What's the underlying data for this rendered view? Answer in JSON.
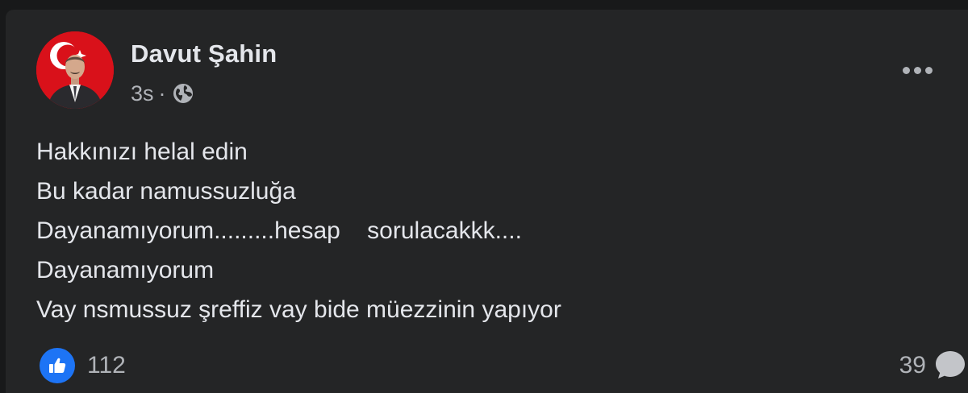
{
  "post": {
    "author": "Davut Şahin",
    "time": "3s",
    "separator": "·",
    "privacy_icon": "globe-icon",
    "more_icon": "more-options-icon",
    "lines": [
      "Hakkınızı helal edin",
      "Bu kadar namussuzluğa",
      "Dayanamıyorum.........hesap    sorulacakkk....",
      "Dayanamıyorum",
      "Vay nsmussuz şreffiz vay bide müezzinin yapıyor"
    ]
  },
  "footer": {
    "reaction_icon": "like-icon",
    "reaction_count": "112",
    "comment_count": "39",
    "comment_icon": "comment-bubble-icon"
  },
  "colors": {
    "background": "#18191a",
    "card": "#242526",
    "primary_text": "#e4e6eb",
    "secondary_text": "#b0b3b8",
    "like_blue": "#1d74f5"
  }
}
